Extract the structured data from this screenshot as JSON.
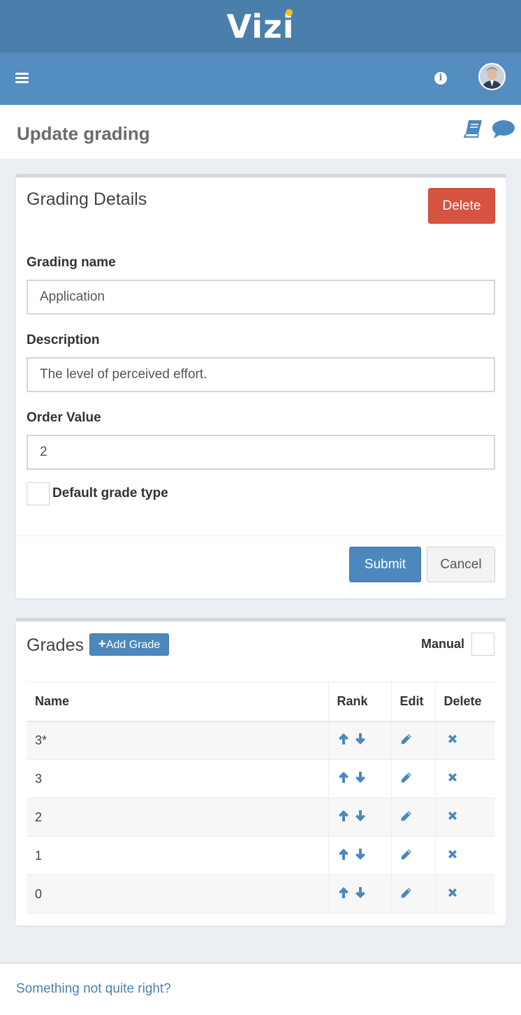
{
  "app": {
    "logo_text": "Vizi",
    "brand_color": "#4a7fab",
    "accent_dot_color": "#f2c218"
  },
  "navbar": {
    "menu_icon": "hamburger-icon",
    "info_icon": "info-icon",
    "info_glyph": "i",
    "avatar": "user-avatar"
  },
  "page": {
    "title": "Update grading",
    "icons": [
      "book-icon",
      "chat-icon"
    ]
  },
  "details": {
    "title": "Grading Details",
    "delete_label": "Delete",
    "name_label": "Grading name",
    "name_value": "Application",
    "description_label": "Description",
    "description_value": "The level of perceived effort.",
    "order_label": "Order Value",
    "order_value": "2",
    "default_label": "Default grade type",
    "default_checked": false,
    "submit_label": "Submit",
    "cancel_label": "Cancel"
  },
  "grades": {
    "title": "Grades",
    "add_label": "Add Grade",
    "add_glyph": "+",
    "manual_label": "Manual",
    "manual_checked": false,
    "columns": [
      "Name",
      "Rank",
      "Edit",
      "Delete"
    ],
    "rows": [
      {
        "name": "3*"
      },
      {
        "name": "3"
      },
      {
        "name": "2"
      },
      {
        "name": "1"
      },
      {
        "name": "0"
      }
    ]
  },
  "footer": {
    "link": "Something not quite right?"
  }
}
